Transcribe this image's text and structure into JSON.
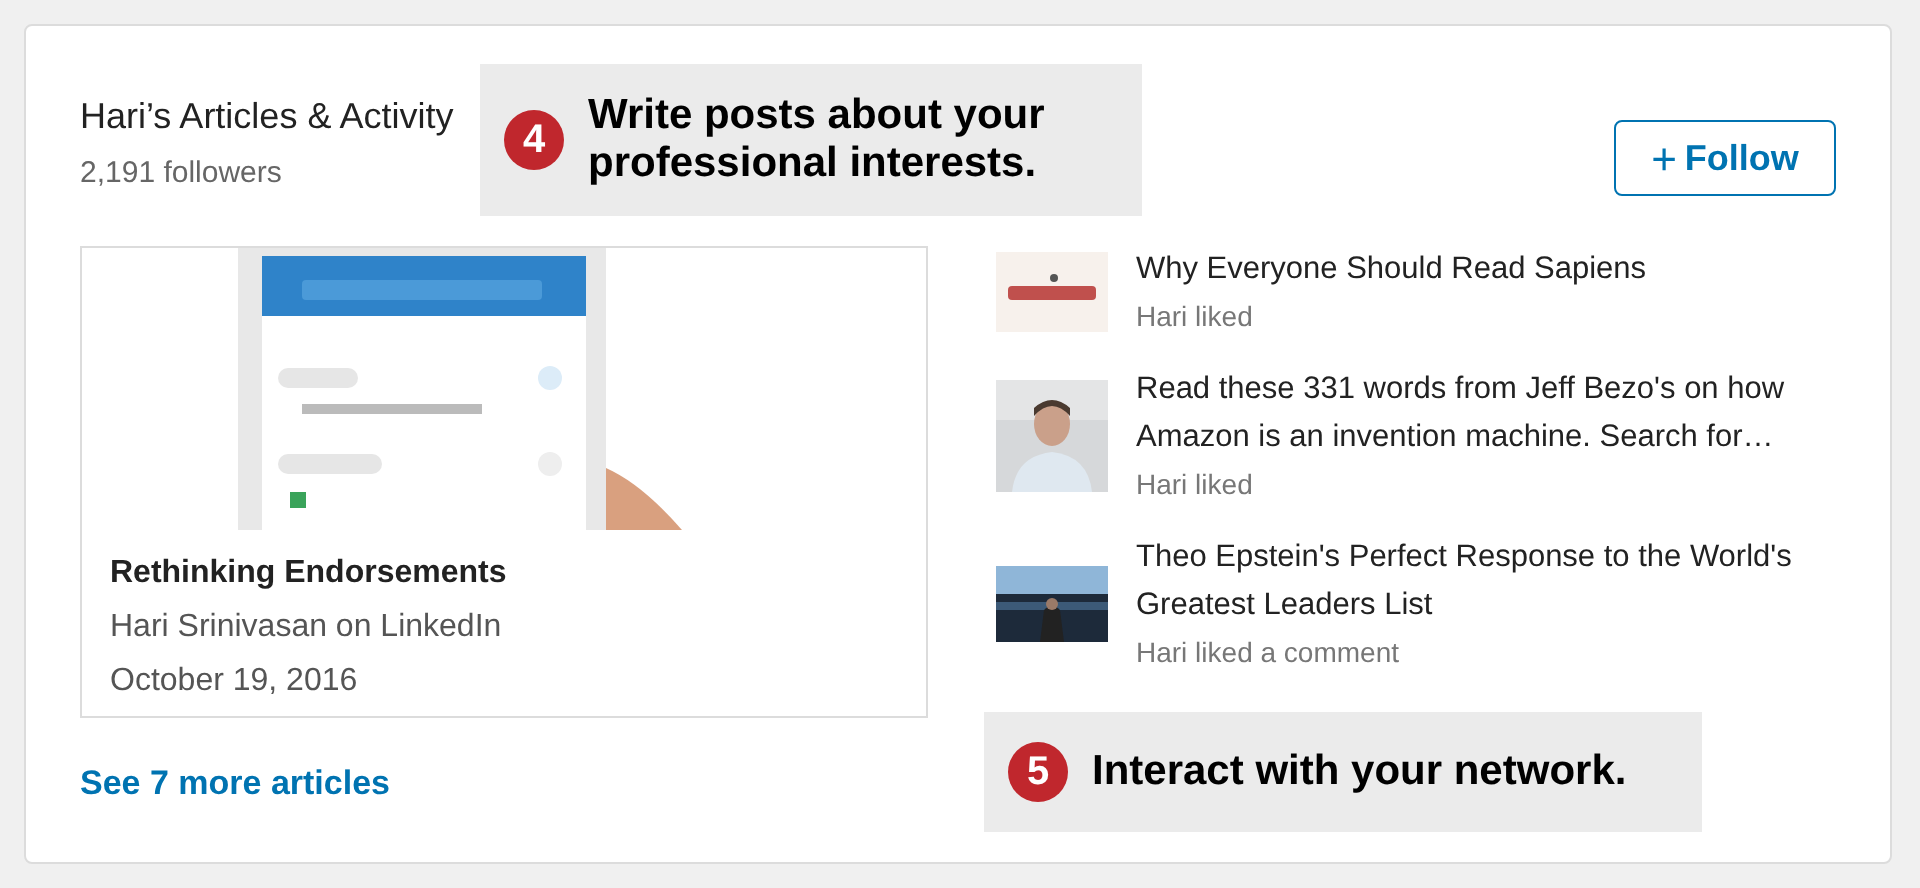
{
  "header": {
    "title": "Hari’s Articles & Activity",
    "followers": "2,191 followers"
  },
  "follow_button": {
    "icon": "+",
    "label": "Follow"
  },
  "article": {
    "title": "Rethinking Endorsements",
    "author": "Hari Srinivasan on LinkedIn",
    "date": "October 19, 2016"
  },
  "activity": [
    {
      "title": "Why Everyone Should Read Sapiens",
      "action": "Hari liked"
    },
    {
      "title": "Read these 331 words from Jeff Bezo's on how Amazon is an invention machine. Search for…",
      "action": "Hari liked"
    },
    {
      "title": "Theo Epstein's Perfect Response to the World's Greatest Leaders List",
      "action": "Hari liked a comment"
    }
  ],
  "more_link": "See 7 more articles",
  "callouts": [
    {
      "number": "4",
      "text": "Write posts about your professional interests."
    },
    {
      "number": "5",
      "text": "Interact with your network."
    }
  ]
}
